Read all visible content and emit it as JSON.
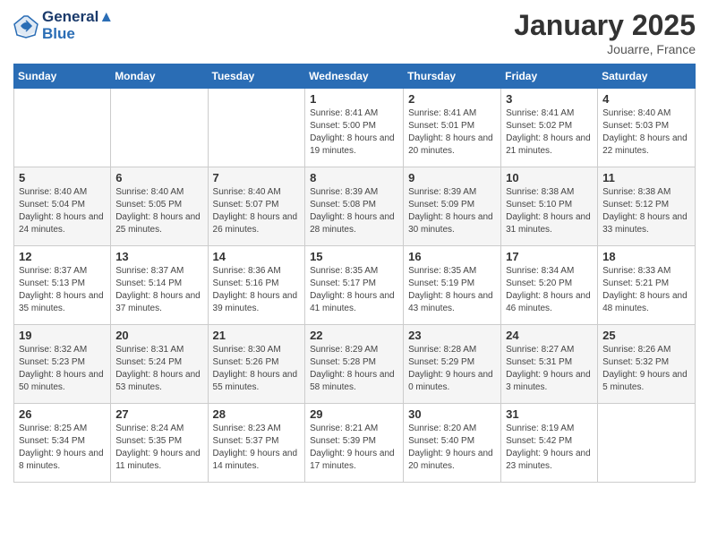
{
  "header": {
    "logo_line1": "General",
    "logo_line2": "Blue",
    "month": "January 2025",
    "location": "Jouarre, France"
  },
  "weekdays": [
    "Sunday",
    "Monday",
    "Tuesday",
    "Wednesday",
    "Thursday",
    "Friday",
    "Saturday"
  ],
  "weeks": [
    [
      {
        "day": "",
        "info": ""
      },
      {
        "day": "",
        "info": ""
      },
      {
        "day": "",
        "info": ""
      },
      {
        "day": "1",
        "info": "Sunrise: 8:41 AM\nSunset: 5:00 PM\nDaylight: 8 hours\nand 19 minutes."
      },
      {
        "day": "2",
        "info": "Sunrise: 8:41 AM\nSunset: 5:01 PM\nDaylight: 8 hours\nand 20 minutes."
      },
      {
        "day": "3",
        "info": "Sunrise: 8:41 AM\nSunset: 5:02 PM\nDaylight: 8 hours\nand 21 minutes."
      },
      {
        "day": "4",
        "info": "Sunrise: 8:40 AM\nSunset: 5:03 PM\nDaylight: 8 hours\nand 22 minutes."
      }
    ],
    [
      {
        "day": "5",
        "info": "Sunrise: 8:40 AM\nSunset: 5:04 PM\nDaylight: 8 hours\nand 24 minutes."
      },
      {
        "day": "6",
        "info": "Sunrise: 8:40 AM\nSunset: 5:05 PM\nDaylight: 8 hours\nand 25 minutes."
      },
      {
        "day": "7",
        "info": "Sunrise: 8:40 AM\nSunset: 5:07 PM\nDaylight: 8 hours\nand 26 minutes."
      },
      {
        "day": "8",
        "info": "Sunrise: 8:39 AM\nSunset: 5:08 PM\nDaylight: 8 hours\nand 28 minutes."
      },
      {
        "day": "9",
        "info": "Sunrise: 8:39 AM\nSunset: 5:09 PM\nDaylight: 8 hours\nand 30 minutes."
      },
      {
        "day": "10",
        "info": "Sunrise: 8:38 AM\nSunset: 5:10 PM\nDaylight: 8 hours\nand 31 minutes."
      },
      {
        "day": "11",
        "info": "Sunrise: 8:38 AM\nSunset: 5:12 PM\nDaylight: 8 hours\nand 33 minutes."
      }
    ],
    [
      {
        "day": "12",
        "info": "Sunrise: 8:37 AM\nSunset: 5:13 PM\nDaylight: 8 hours\nand 35 minutes."
      },
      {
        "day": "13",
        "info": "Sunrise: 8:37 AM\nSunset: 5:14 PM\nDaylight: 8 hours\nand 37 minutes."
      },
      {
        "day": "14",
        "info": "Sunrise: 8:36 AM\nSunset: 5:16 PM\nDaylight: 8 hours\nand 39 minutes."
      },
      {
        "day": "15",
        "info": "Sunrise: 8:35 AM\nSunset: 5:17 PM\nDaylight: 8 hours\nand 41 minutes."
      },
      {
        "day": "16",
        "info": "Sunrise: 8:35 AM\nSunset: 5:19 PM\nDaylight: 8 hours\nand 43 minutes."
      },
      {
        "day": "17",
        "info": "Sunrise: 8:34 AM\nSunset: 5:20 PM\nDaylight: 8 hours\nand 46 minutes."
      },
      {
        "day": "18",
        "info": "Sunrise: 8:33 AM\nSunset: 5:21 PM\nDaylight: 8 hours\nand 48 minutes."
      }
    ],
    [
      {
        "day": "19",
        "info": "Sunrise: 8:32 AM\nSunset: 5:23 PM\nDaylight: 8 hours\nand 50 minutes."
      },
      {
        "day": "20",
        "info": "Sunrise: 8:31 AM\nSunset: 5:24 PM\nDaylight: 8 hours\nand 53 minutes."
      },
      {
        "day": "21",
        "info": "Sunrise: 8:30 AM\nSunset: 5:26 PM\nDaylight: 8 hours\nand 55 minutes."
      },
      {
        "day": "22",
        "info": "Sunrise: 8:29 AM\nSunset: 5:28 PM\nDaylight: 8 hours\nand 58 minutes."
      },
      {
        "day": "23",
        "info": "Sunrise: 8:28 AM\nSunset: 5:29 PM\nDaylight: 9 hours\nand 0 minutes."
      },
      {
        "day": "24",
        "info": "Sunrise: 8:27 AM\nSunset: 5:31 PM\nDaylight: 9 hours\nand 3 minutes."
      },
      {
        "day": "25",
        "info": "Sunrise: 8:26 AM\nSunset: 5:32 PM\nDaylight: 9 hours\nand 5 minutes."
      }
    ],
    [
      {
        "day": "26",
        "info": "Sunrise: 8:25 AM\nSunset: 5:34 PM\nDaylight: 9 hours\nand 8 minutes."
      },
      {
        "day": "27",
        "info": "Sunrise: 8:24 AM\nSunset: 5:35 PM\nDaylight: 9 hours\nand 11 minutes."
      },
      {
        "day": "28",
        "info": "Sunrise: 8:23 AM\nSunset: 5:37 PM\nDaylight: 9 hours\nand 14 minutes."
      },
      {
        "day": "29",
        "info": "Sunrise: 8:21 AM\nSunset: 5:39 PM\nDaylight: 9 hours\nand 17 minutes."
      },
      {
        "day": "30",
        "info": "Sunrise: 8:20 AM\nSunset: 5:40 PM\nDaylight: 9 hours\nand 20 minutes."
      },
      {
        "day": "31",
        "info": "Sunrise: 8:19 AM\nSunset: 5:42 PM\nDaylight: 9 hours\nand 23 minutes."
      },
      {
        "day": "",
        "info": ""
      }
    ]
  ]
}
